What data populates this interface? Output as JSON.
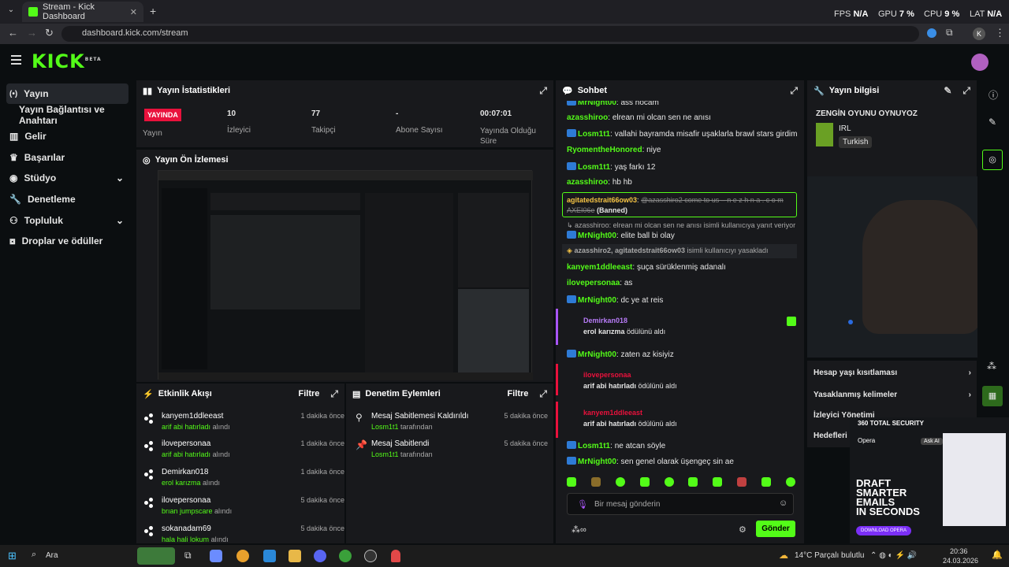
{
  "browser": {
    "tab_title": "Stream - Kick Dashboard",
    "url": "dashboard.kick.com/stream",
    "profile_initial": "K",
    "overlay": {
      "fps_label": "FPS",
      "fps_val": "N/A",
      "gpu_label": "GPU",
      "gpu_val": "7 %",
      "cpu_label": "CPU",
      "cpu_val": "9 %",
      "lat_label": "LAT",
      "lat_val": "N/A"
    }
  },
  "app": {
    "logo": "KICK",
    "logo_sup": "BETA"
  },
  "sidebar": {
    "items": [
      {
        "label": "Yayın"
      },
      {
        "label": "Yayın Bağlantısı ve Anahtarı"
      },
      {
        "label": "Gelir"
      },
      {
        "label": "Başarılar"
      },
      {
        "label": "Stüdyo"
      },
      {
        "label": "Denetleme"
      },
      {
        "label": "Topluluk"
      },
      {
        "label": "Droplar ve ödüller"
      }
    ]
  },
  "stats": {
    "title": "Yayın İstatistikleri",
    "live_badge": "YAYINDA",
    "live_label": "Yayın",
    "viewers": "10",
    "viewers_label": "İzleyici",
    "followers": "77",
    "followers_label": "Takipçi",
    "subs": "-",
    "subs_label": "Abone Sayısı",
    "duration": "00:07:01",
    "duration_label": "Yayında Olduğu Süre"
  },
  "preview": {
    "title": "Yayın Ön İzlemesi"
  },
  "activity": {
    "title": "Etkinlik Akışı",
    "filter": "Filtre",
    "rows": [
      {
        "name": "kanyem1ddleeast",
        "reward": "arif abi hatırladı",
        "suffix": "alındı",
        "time": "1 dakika önce"
      },
      {
        "name": "ilovepersonaa",
        "reward": "arif abi hatırladı",
        "suffix": "alındı",
        "time": "1 dakika önce"
      },
      {
        "name": "Demirkan018",
        "reward": "erol karızma",
        "suffix": "alındı",
        "time": "1 dakika önce"
      },
      {
        "name": "ilovepersonaa",
        "reward": "brıan jumpscare",
        "suffix": "alındı",
        "time": "5 dakika önce"
      },
      {
        "name": "sokanadam69",
        "reward": "hala hali lokum",
        "suffix": "alındı",
        "time": "5 dakika önce"
      }
    ]
  },
  "moderation": {
    "title": "Denetim Eylemleri",
    "filter": "Filtre",
    "rows": [
      {
        "action": "Mesaj Sabitlemesi Kaldırıldı",
        "by": "Losm1t1",
        "suffix": "tarafından",
        "time": "5 dakika önce"
      },
      {
        "action": "Mesaj Sabitlendi",
        "by": "Losm1t1",
        "suffix": "tarafından",
        "time": "5 dakika önce"
      }
    ]
  },
  "chat": {
    "title": "Sohbet",
    "lines": [
      {
        "user": "MrNight00",
        "color": "#53fc18",
        "text": "ass hocam",
        "badge": true
      },
      {
        "user": "azasshiroo",
        "color": "#53fc18",
        "text": "elrean mi olcan sen ne anısı",
        "badge": false
      },
      {
        "user": "Losm1t1",
        "color": "#53fc18",
        "text": "vallahi bayramda misafir uşaklarla brawl stars girdim",
        "badge": true
      },
      {
        "user": "RyomentheHonored",
        "color": "#53fc18",
        "text": "niye",
        "badge": false
      },
      {
        "user": "Losm1t1",
        "color": "#53fc18",
        "text": "yaş farkı 12",
        "badge": true
      },
      {
        "user": "azasshiroo",
        "color": "#53fc18",
        "text": "hb hb",
        "badge": false
      }
    ],
    "banned": {
      "user": "agitatedstrait66ow03",
      "text": "@azasshiro2 come to us – n e z h n a . c o m AXEI06e",
      "tag": "(Banned)"
    },
    "reply_ref": "azasshiroo: elrean mi olcan sen ne anısı isimli kullanıcıya yanıt veriyor",
    "lines2": [
      {
        "user": "MrNight00",
        "color": "#53fc18",
        "text": "elite ball bi olay",
        "badge": true
      }
    ],
    "ban_notice": {
      "users": "azasshiro2, agitatedstrait66ow03",
      "text": "isimli kullanıcıyı yasakladı"
    },
    "lines3": [
      {
        "user": "kanyem1ddleeast",
        "color": "#53fc18",
        "text": "şuça sürüklenmiş adanalı"
      },
      {
        "user": "ilovepersonaa",
        "color": "#53fc18",
        "text": "as"
      },
      {
        "user": "MrNight00",
        "color": "#53fc18",
        "text": "dc ye at reis"
      }
    ],
    "redeem1": {
      "user": "Demirkan018",
      "reward": "erol karızma",
      "suffix": "ödülünü aldı"
    },
    "line4": {
      "user": "MrNight00",
      "text": "zaten az kisiyiz"
    },
    "redeem2": {
      "user": "ilovepersonaa",
      "reward": "arif abi hatırladı",
      "suffix": "ödülünü aldı"
    },
    "redeem3": {
      "user": "kanyem1ddleeast",
      "reward": "arif abi hatırladı",
      "suffix": "ödülünü aldı"
    },
    "line5": {
      "user": "Losm1t1",
      "text": "ne atcan söyle"
    },
    "line6": {
      "user": "MrNight00",
      "text": "sen genel olarak üşengeç sin ae"
    },
    "input_placeholder": "Bir mesaj gönderin",
    "send": "Gönder"
  },
  "streaminfo": {
    "title": "Yayın bilgisi",
    "stream_title": "ZENGİN OYUNU OYNUYOZ",
    "category": "IRL",
    "language": "Turkish",
    "options": [
      "Hesap yaşı kısıtlaması",
      "Yasaklanmış kelimeler",
      "İzleyici Yönetimi",
      "Hedefleri b"
    ]
  },
  "ad": {
    "brand": "360 TOTAL SECURITY",
    "browser": "Opera",
    "ask": "Ask AI",
    "headline1": "DRAFT",
    "headline2": "SMARTER",
    "headline3": "EMAILS",
    "headline4": "IN SECONDS",
    "cta": "DOWNLOAD OPERA"
  },
  "taskbar": {
    "search": "Ara",
    "weather": "14°C  Parçalı bulutlu",
    "time": "20:36",
    "date": "24.03.2026"
  }
}
